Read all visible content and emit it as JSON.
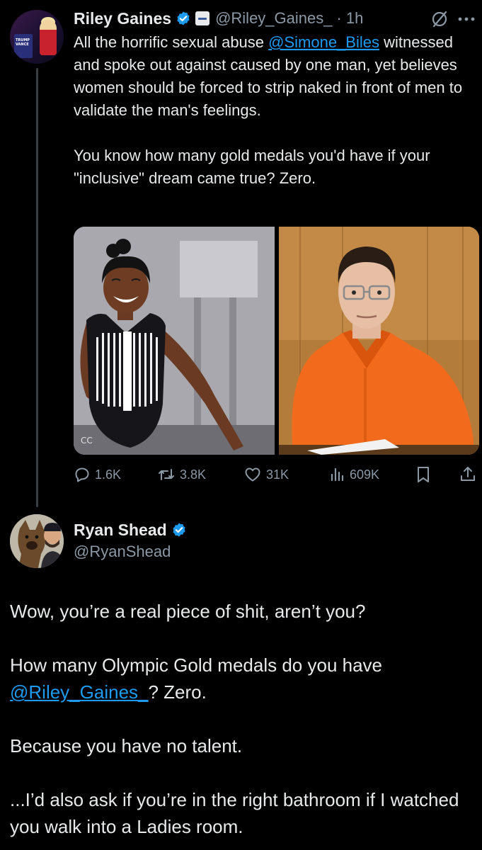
{
  "tweet": {
    "author_name": "Riley Gaines",
    "author_handle": "@Riley_Gaines_",
    "separator": "·",
    "time": "1h",
    "avatar_podium_text": "TRUMP VANCE",
    "text_part1_prefix": "All the horrific sexual abuse ",
    "text_mention": "@Simone_Biles",
    "text_part1_suffix": " witnessed and spoke out against caused by one man, yet believes women should be forced to strip naked in front of men to validate the man's feelings.",
    "text_part2": "You know how many gold medals you'd have if your \"inclusive\" dream came true? Zero.",
    "media_left_watermark": "CC",
    "stats": {
      "replies": "1.6K",
      "reposts": "3.8K",
      "likes": "31K",
      "views": "609K"
    },
    "icons": [
      "verified-badge-icon",
      "org-badge-icon",
      "grok-icon",
      "more-icon",
      "reply-icon",
      "repost-icon",
      "like-icon",
      "views-icon",
      "bookmark-icon",
      "share-icon"
    ]
  },
  "reply": {
    "author_name": "Ryan Shead",
    "author_handle": "@RyanShead",
    "line1": "Wow, you’re a real piece of shit, aren’t you?",
    "line2_prefix": "How many Olympic Gold medals do you have ",
    "line2_mention": "@Riley_Gaines_",
    "line2_suffix": "? Zero.",
    "line3": "Because you have no talent.",
    "line4": "...I’d also ask if you’re in the right bathroom if I watched you walk into a Ladies room."
  },
  "colors": {
    "background": "#000000",
    "text": "#e7e9ea",
    "secondary": "#8b98a5",
    "link": "#1d9bf0",
    "verified": "#1d9bf0",
    "prison_orange": "#f26a1b"
  }
}
